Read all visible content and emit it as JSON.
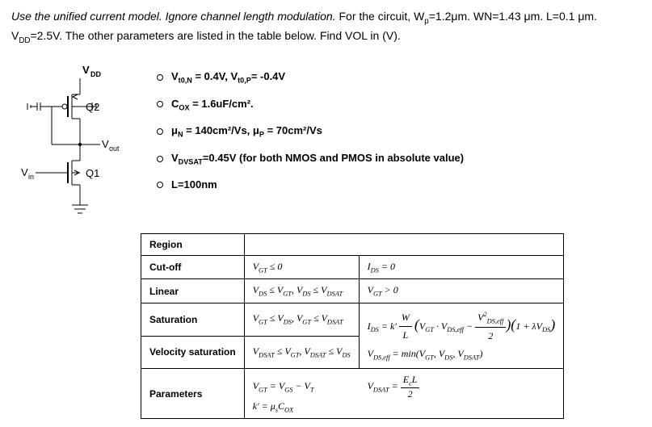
{
  "prompt": {
    "italic": "Use the unified current model. Ignore channel length modulation.",
    "rest1": " For the circuit, W",
    "sub1": "p",
    "rest2": "=1.2μm. WN=1.43 μm. L=0.1 μm. V",
    "sub2": "DD",
    "rest3": "=2.5V. The other parameters are listed in the table below.  Find VOL in (V)."
  },
  "circuit": {
    "vdd": "V",
    "vdd_sub": "DD",
    "q2": "Q2",
    "vout": "V",
    "vout_sub": "out",
    "q1": "Q1",
    "vin": "V",
    "vin_sub": "in"
  },
  "params": {
    "p1_a": "V",
    "p1_a_sub": "t0,N",
    "p1_mid": " = 0.4V, V",
    "p1_b_sub": "t0,P",
    "p1_end": "= -0.4V",
    "p2_a": "C",
    "p2_a_sub": "OX",
    "p2_rest": " = 1.6uF/cm².",
    "p3_a": "μ",
    "p3_a_sub": "N",
    "p3_mid": " = 140cm²/Vs, μ",
    "p3_b_sub": "P",
    "p3_end": " = 70cm²/Vs",
    "p4_a": "V",
    "p4_a_sub": "DVSAT",
    "p4_rest": "=0.45V (for both NMOS and PMOS in absolute value)",
    "p5": "L=100nm"
  },
  "table": {
    "h1": "Region",
    "r1c1": "Cut-off",
    "r1c2_a": "V",
    "r1c2_a_sub": "GT",
    "r1c2_rest": " ≤ 0",
    "r1c3_a": "I",
    "r1c3_a_sub": "DS",
    "r1c3_rest": " = 0",
    "r2c1": "Linear",
    "r2c2_a": "V",
    "r2c2_a_sub": "DS",
    "r2c2_mid": " ≤ V",
    "r2c2_b_sub": "GT",
    "r2c2_mid2": ",  V",
    "r2c2_c_sub": "DS",
    "r2c2_mid3": " ≤ V",
    "r2c2_d_sub": "DSAT",
    "r2c3_a": "V",
    "r2c3_a_sub": "GT",
    "r2c3_rest": " > 0",
    "r3c1": "Saturation",
    "r3c2_a": "V",
    "r3c2_a_sub": "GT",
    "r3c2_mid": " ≤ V",
    "r3c2_b_sub": "DS",
    "r3c2_mid2": ",  V",
    "r3c2_c_sub": "GT",
    "r3c2_mid3": " ≤ V",
    "r3c2_d_sub": "DSAT",
    "r4c1": "Velocity saturation",
    "r4c2_a": "V",
    "r4c2_a_sub": "DSAT",
    "r4c2_mid": " ≤ V",
    "r4c2_b_sub": "GT",
    "r4c2_mid2": ",  V",
    "r4c2_c_sub": "DSAT",
    "r4c2_mid3": " ≤ V",
    "r4c2_d_sub": "DS",
    "eq3_a": "I",
    "eq3_a_sub": "DS",
    "eq3_mid1": " = k' ",
    "eq3_frac_num": "W",
    "eq3_frac_den": "L",
    "eq3_open": "(",
    "eq3_vgt": "V",
    "eq3_vgt_sub": "GT",
    "eq3_dot1": " · V",
    "eq3_vdseff_sub": "DS,eff",
    "eq3_minus": " − ",
    "eq3_frac2_num_a": "V",
    "eq3_frac2_num_sub": "DS,eff",
    "eq3_frac2_num_sup": "2",
    "eq3_frac2_den": "2",
    "eq3_close1": ")(",
    "eq3_one": "1 + λV",
    "eq3_lam_sub": "DS",
    "eq3_close2": ")",
    "eq4_a": "V",
    "eq4_a_sub": "DS,eff",
    "eq4_mid": " = min(V",
    "eq4_b_sub": "GT",
    "eq4_c": ", V",
    "eq4_c_sub": "DS",
    "eq4_d": ", V",
    "eq4_d_sub": "DSAT",
    "eq4_end": ")",
    "r5c1": "Parameters",
    "r5eq1_a": "V",
    "r5eq1_a_sub": "GT",
    "r5eq1_mid": " = V",
    "r5eq1_b_sub": "GS",
    "r5eq1_mid2": " − V",
    "r5eq1_c_sub": "T",
    "r5eq2_a": "k' = μ",
    "r5eq2_a_sub": "s",
    "r5eq2_b": "C",
    "r5eq2_b_sub": "OX",
    "r5eq3_a": "V",
    "r5eq3_a_sub": "DSAT",
    "r5eq3_mid": " = ",
    "r5eq3_num_a": "E",
    "r5eq3_num_sub": "c",
    "r5eq3_num_b": "L",
    "r5eq3_den": "2"
  }
}
